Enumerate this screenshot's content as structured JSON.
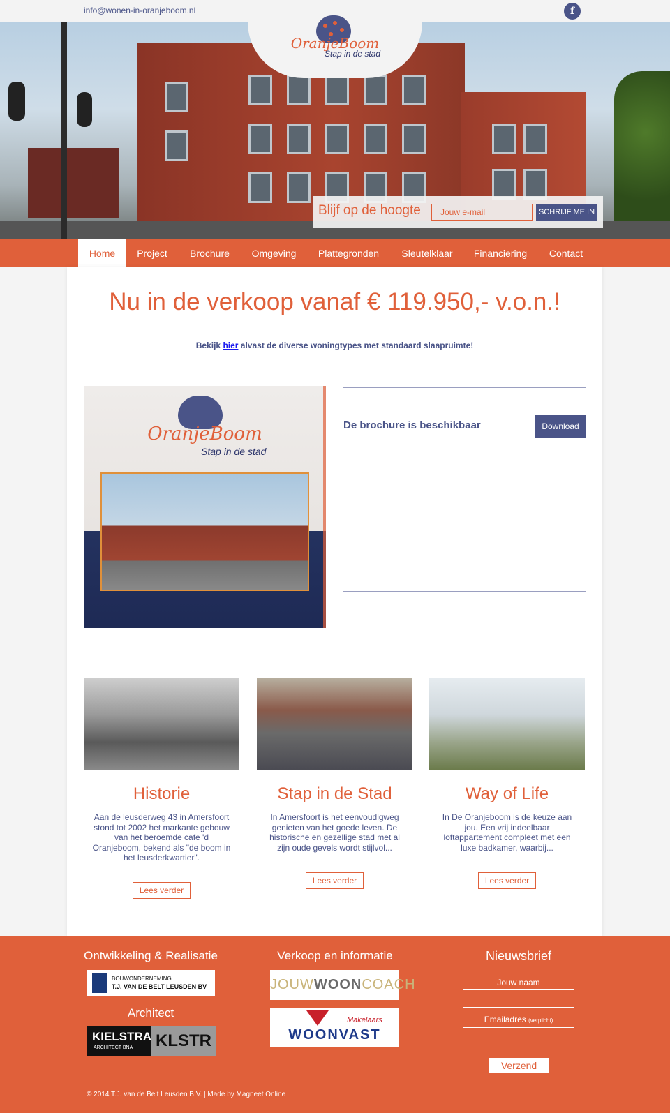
{
  "topbar": {
    "email": "info@wonen-in-oranjeboom.nl",
    "facebook_glyph": "f"
  },
  "logo": {
    "name": "OranjeBoom",
    "tagline": "Stap in de stad"
  },
  "subscribe": {
    "label": "Blijf op de hoogte",
    "placeholder": "Jouw e-mail",
    "button": "SCHRIJF ME IN"
  },
  "nav": {
    "items": [
      "Home",
      "Project",
      "Brochure",
      "Omgeving",
      "Plattegronden",
      "Sleutelklaar",
      "Financiering",
      "Contact"
    ],
    "active": "Home"
  },
  "main": {
    "headline": "Nu in de verkoop vanaf € 119.950,- v.o.n.!",
    "sub_before": "Bekijk",
    "sub_link": "hier",
    "sub_after": "alvast de diverse woningtypes met standaard slaapruimte!"
  },
  "brochure": {
    "text": "De brochure is beschikbaar",
    "download": "Download",
    "cover_name": "OranjeBoom",
    "cover_tagline": "Stap in de stad"
  },
  "cards": [
    {
      "title": "Historie",
      "text": "Aan de leusderweg 43 in Amersfoort stond tot 2002 het markante gebouw van het beroemde cafe 'd Oranjeboom, bekend als \"de boom in het leusderkwartier\".",
      "more": "Lees verder"
    },
    {
      "title": "Stap in de Stad",
      "text": "In Amersfoort is het eenvoudigweg genieten van het goede leven. De historische en gezellige stad met al zijn oude gevels wordt stijlvol...",
      "more": "Lees verder"
    },
    {
      "title": "Way of Life",
      "text": "In De Oranjeboom is de keuze aan jou. Een vrij indeelbaar loftappartement compleet met een luxe badkamer, waarbij...",
      "more": "Lees verder"
    }
  ],
  "footer": {
    "col1_title": "Ontwikkeling & Realisatie",
    "belt_line1": "BOUWONDERNEMING",
    "belt_line2": "T.J. VAN DE BELT LEUSDEN BV",
    "architect_title": "Architect",
    "kielstra": "KIELSTRA",
    "kielstra_sub": "ARCHITECT BNA",
    "klstr": "KLSTR",
    "col2_title": "Verkoop en informatie",
    "jouwwooncoach_a": "JOUW",
    "jouwwooncoach_b": "WOON",
    "jouwwooncoach_c": "COACH",
    "woonvast_small": "Makelaars",
    "woonvast": "WOONVAST",
    "col3_title": "Nieuwsbrief",
    "name_label": "Jouw naam",
    "email_label": "Emailadres",
    "required": "(verplicht)",
    "send": "Verzend",
    "copyright": "© 2014 T.J. van de Belt Leusden B.V. | Made by Magneet Online"
  },
  "colors": {
    "accent": "#e0603a",
    "navy": "#4a5488",
    "background": "#f4f4f4"
  }
}
